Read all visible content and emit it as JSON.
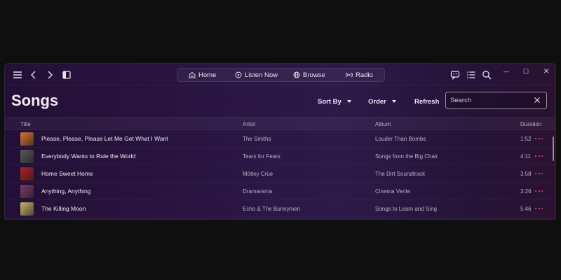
{
  "nav": {
    "items": [
      {
        "label": "Home",
        "icon": "home-icon"
      },
      {
        "label": "Listen Now",
        "icon": "play-circle-icon"
      },
      {
        "label": "Browse",
        "icon": "globe-icon"
      },
      {
        "label": "Radio",
        "icon": "radio-icon"
      }
    ]
  },
  "window_controls": {
    "minimize": "—",
    "maximize": "☐",
    "close": "✕"
  },
  "header": {
    "title": "Songs",
    "sort_by_label": "Sort By",
    "order_label": "Order",
    "refresh_label": "Refresh",
    "search_placeholder": "Search"
  },
  "table": {
    "columns": {
      "title": "Title",
      "artist": "Artist",
      "album": "Album",
      "duration": "Duration"
    },
    "rows": [
      {
        "title": "Please, Please, Please Let Me Get What I Want",
        "artist": "The Smiths",
        "album": "Louder Than Bombs",
        "duration": "1:52",
        "art_color": "#d9732f"
      },
      {
        "title": "Everybody Wants to Rule the World",
        "artist": "Tears for Fears",
        "album": "Songs from the Big Chair",
        "duration": "4:11",
        "art_color": "#5a5a5a"
      },
      {
        "title": "Home Sweet Home",
        "artist": "Mötley Crüe",
        "album": "The Dirt Soundtrack",
        "duration": "3:58",
        "art_color": "#b3202a"
      },
      {
        "title": "Anything, Anything",
        "artist": "Dramarama",
        "album": "Cinema Verite",
        "duration": "3:26",
        "art_color": "#7a3a6a"
      },
      {
        "title": "The Killing Moon",
        "artist": "Echo & The Bunnymen",
        "album": "Songs to Learn and Sing",
        "duration": "5:46",
        "art_color": "#c8b46a"
      }
    ]
  },
  "colors": {
    "accent": "#e8446a"
  }
}
